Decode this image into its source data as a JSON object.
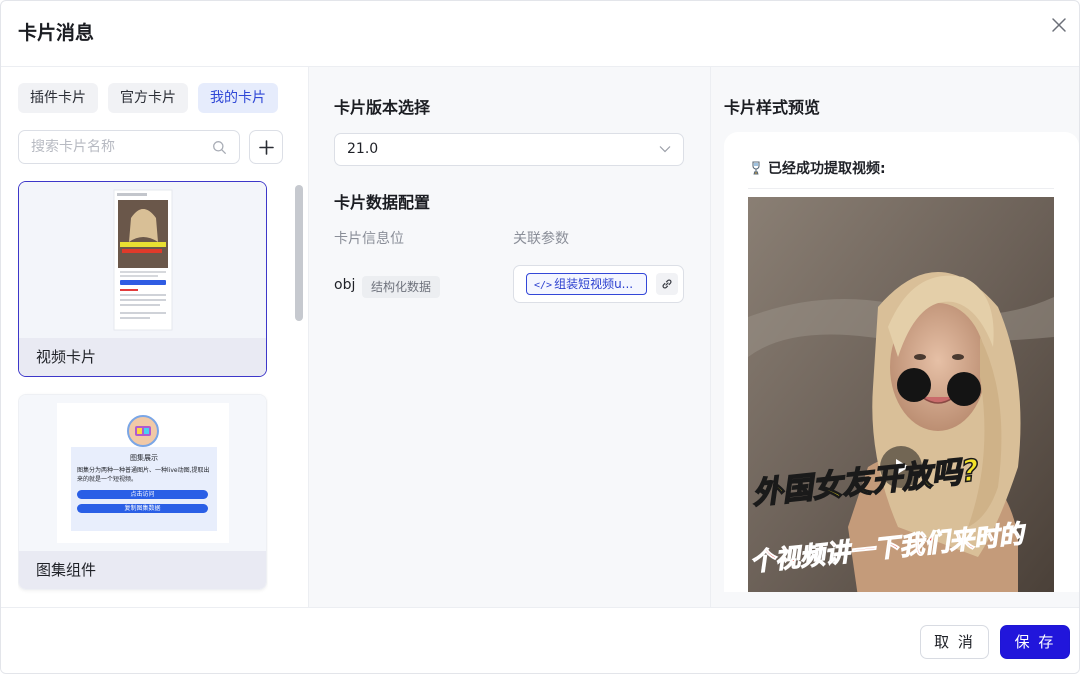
{
  "modal": {
    "title": "卡片消息"
  },
  "left": {
    "tabs": [
      {
        "label": "插件卡片",
        "active": false
      },
      {
        "label": "官方卡片",
        "active": false
      },
      {
        "label": "我的卡片",
        "active": true
      }
    ],
    "search_placeholder": "搜索卡片名称",
    "cards": [
      {
        "label": "视频卡片",
        "selected": true
      },
      {
        "label": "图集组件",
        "selected": false,
        "thumb": {
          "title": "图集展示",
          "text": "图集分为两种一种普通图片、一种live动图,提取出来的就是一个短视频。",
          "btn1": "点击访问",
          "btn2": "复制图集数据"
        }
      }
    ]
  },
  "middle": {
    "version_title": "卡片版本选择",
    "version_value": "21.0",
    "config_title": "卡片数据配置",
    "col_info": "卡片信息位",
    "col_param": "关联参数",
    "row": {
      "key": "obj",
      "type": "结构化数据",
      "param": "组装短视频u..."
    }
  },
  "right": {
    "title": "卡片样式预览",
    "preview_heading": "已经成功提取视频:",
    "video_caption_1": "外国女友开放吗?",
    "video_caption_2": "个视频讲一下我们来时的"
  },
  "footer": {
    "cancel": "取 消",
    "save": "保 存"
  },
  "colors": {
    "primary": "#2116db",
    "active_tab_text": "#2f47d6",
    "tag_border": "#3347d8"
  }
}
